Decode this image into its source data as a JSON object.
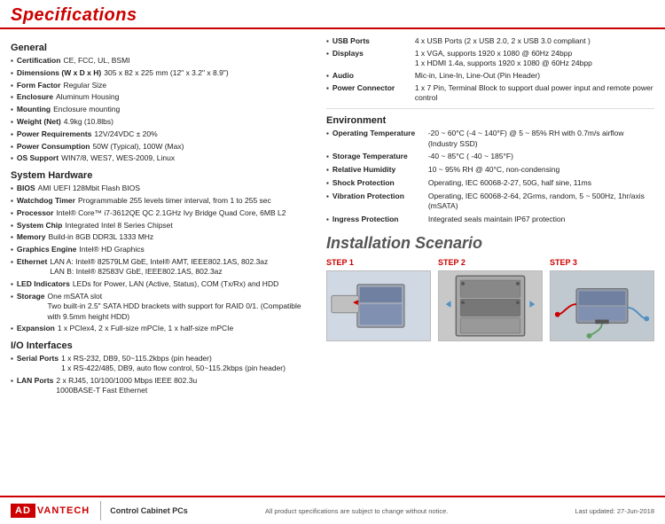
{
  "header": {
    "title": "Specifications"
  },
  "left": {
    "general_title": "General",
    "general_items": [
      {
        "key": "Certification",
        "val": "CE, FCC, UL, BSMI"
      },
      {
        "key": "Dimensions (W x D x H)",
        "val": "305 x 82 x 225 mm (12\" x 3.2\" x 8.9\")"
      },
      {
        "key": "Form Factor",
        "val": "Regular Size"
      },
      {
        "key": "Enclosure",
        "val": "Aluminum Housing"
      },
      {
        "key": "Mounting",
        "val": "Enclosure mounting"
      },
      {
        "key": "Weight (Net)",
        "val": "4.9kg (10.8lbs)"
      },
      {
        "key": "Power Requirements",
        "val": "12V/24VDC ± 20%"
      },
      {
        "key": "Power Consumption",
        "val": "50W (Typical), 100W (Max)"
      },
      {
        "key": "OS Support",
        "val": "WIN7/8, WES7, WES-2009, Linux"
      }
    ],
    "syshw_title": "System Hardware",
    "syshw_items": [
      {
        "key": "BIOS",
        "val": "AMI UEFI 128Mbit Flash BIOS"
      },
      {
        "key": "Watchdog Timer",
        "val": "Programmable 255 levels timer interval, from 1 to 255 sec"
      },
      {
        "key": "Processor",
        "val": "Intel® Core™ i7-3612QE QC 2.1GHz Ivy Bridge Quad Core, 6MB L2"
      },
      {
        "key": "System Chip",
        "val": "Integrated Intel 8 Series Chipset"
      },
      {
        "key": "Memory",
        "val": "Build-in 8GB DDR3L 1333 MHz"
      },
      {
        "key": "Graphics Engine",
        "val": "Intel® HD Graphics"
      },
      {
        "key": "Ethernet",
        "val": "LAN A: Intel® 82579LM GbE, Intel® AMT, IEEE802.1AS, 802.3az\nLAN B: Intel® 82583V GbE, IEEE802.1AS, 802.3az"
      },
      {
        "key": "LED Indicators",
        "val": "LEDs for Power, LAN (Active, Status), COM (Tx/Rx) and HDD"
      },
      {
        "key": "Storage",
        "val": "One mSATA slot\nTwo built-in 2.5\" SATA HDD brackets with support for RAID 0/1. (Compatible with 9.5mm height HDD)"
      },
      {
        "key": "Expansion",
        "val": "1 x PCIex4, 2 x Full-size mPCIe, 1 x half-size mPCIe"
      }
    ],
    "io_title": "I/O Interfaces",
    "io_items": [
      {
        "key": "Serial Ports",
        "val": "1 x RS-232, DB9, 50~115.2kbps (pin header)\n1 x RS-422/485, DB9, auto flow control, 50~115.2kbps (pin header)"
      },
      {
        "key": "LAN Ports",
        "val": "2 x RJ45, 10/100/1000 Mbps IEEE 802.3u\n1000BASE-T Fast Ethernet"
      }
    ]
  },
  "right": {
    "io_items": [
      {
        "key": "USB Ports",
        "val": "4 x USB Ports (2 x USB 2.0, 2 x USB 3.0 compliant )"
      },
      {
        "key": "Displays",
        "val": "1 x VGA, supports 1920 x 1080 @ 60Hz 24bpp\n1 x HDMI 1.4a, supports 1920 x 1080 @ 60Hz 24bpp"
      },
      {
        "key": "Audio",
        "val": "Mic-in, Line-In, Line-Out (Pin Header)"
      },
      {
        "key": "Power Connector",
        "val": "1 x 7 Pin, Terminal Block to support dual power input and remote power control"
      }
    ],
    "env_title": "Environment",
    "env_items": [
      {
        "key": "Operating Temperature",
        "val": "-20 ~ 60°C (-4 ~ 140°F) @ 5 ~ 85% RH with 0.7m/s airflow (Industry SSD)"
      },
      {
        "key": "Storage Temperature",
        "val": "-40 ~ 85°C ( -40 ~ 185°F)"
      },
      {
        "key": "Relative Humidity",
        "val": "10 ~ 95% RH @ 40°C, non-condensing"
      },
      {
        "key": "Shock Protection",
        "val": "Operating, IEC 60068-2-27, 50G, half sine, 11ms"
      },
      {
        "key": "Vibration Protection",
        "val": "Operating, IEC 60068-2-64, 2Grms, random, 5 ~ 500Hz, 1hr/axis (mSATA)"
      },
      {
        "key": "Ingress Protection",
        "val": "Integrated seals maintain IP67 protection"
      }
    ],
    "install_title": "Installation Scenario",
    "steps": [
      {
        "label": "STEP 1"
      },
      {
        "label": "STEP 2"
      },
      {
        "label": "STEP 3"
      }
    ]
  },
  "footer": {
    "logo_ad": "AD",
    "logo_vantech": "VANTECH",
    "divider": "|",
    "product_line": "Control Cabinet PCs",
    "notice": "All product specifications are subject to change without notice.",
    "date": "Last updated: 27-Jun-2018"
  }
}
